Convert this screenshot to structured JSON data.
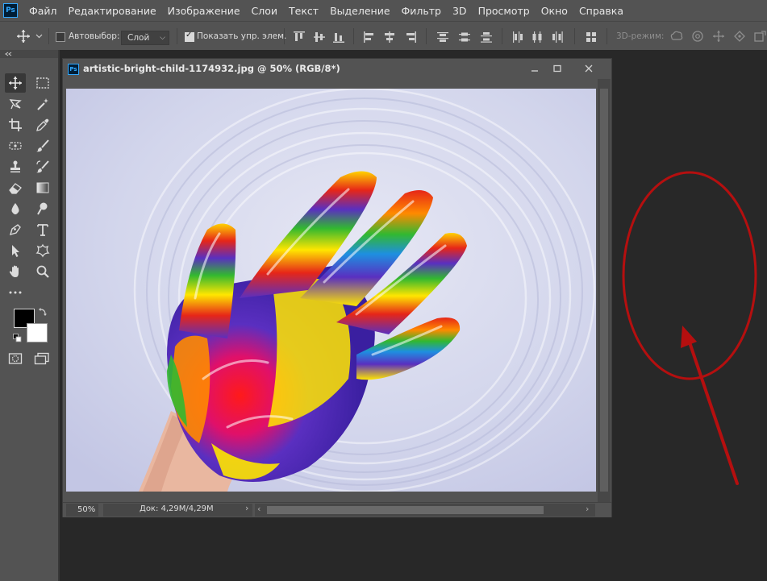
{
  "app": {
    "logo_text": "Ps"
  },
  "menu": [
    "Файл",
    "Редактирование",
    "Изображение",
    "Слои",
    "Текст",
    "Выделение",
    "Фильтр",
    "3D",
    "Просмотр",
    "Окно",
    "Справка"
  ],
  "options_bar": {
    "auto_select_label": "Автовыбор:",
    "auto_select_checked": false,
    "auto_select_target": "Слой",
    "show_transform_label": "Показать упр. элем.",
    "show_transform_checked": true,
    "mode_3d_label": "3D-режим:"
  },
  "tools": [
    {
      "name": "move-tool-icon",
      "active": true
    },
    {
      "name": "marquee-tool-icon"
    },
    {
      "name": "lasso-tool-icon"
    },
    {
      "name": "magic-wand-tool-icon"
    },
    {
      "name": "crop-tool-icon"
    },
    {
      "name": "eyedropper-tool-icon"
    },
    {
      "name": "healing-brush-tool-icon"
    },
    {
      "name": "brush-tool-icon"
    },
    {
      "name": "clone-stamp-tool-icon"
    },
    {
      "name": "history-brush-tool-icon"
    },
    {
      "name": "eraser-tool-icon"
    },
    {
      "name": "gradient-tool-icon"
    },
    {
      "name": "blur-tool-icon"
    },
    {
      "name": "dodge-tool-icon"
    },
    {
      "name": "pen-tool-icon"
    },
    {
      "name": "type-tool-icon"
    },
    {
      "name": "path-selection-tool-icon"
    },
    {
      "name": "custom-shape-tool-icon"
    },
    {
      "name": "hand-tool-icon"
    },
    {
      "name": "zoom-tool-icon"
    }
  ],
  "colors": {
    "foreground": "#000000",
    "background": "#ffffff",
    "annotation": "#b50f0f",
    "ui_bg": "#535353",
    "workspace": "#282828"
  },
  "document": {
    "title": "artistic-bright-child-1174932.jpg @ 50% (RGB/8*)",
    "zoom": "50%",
    "doc_info": "Док: 4,29M/4,29M"
  }
}
